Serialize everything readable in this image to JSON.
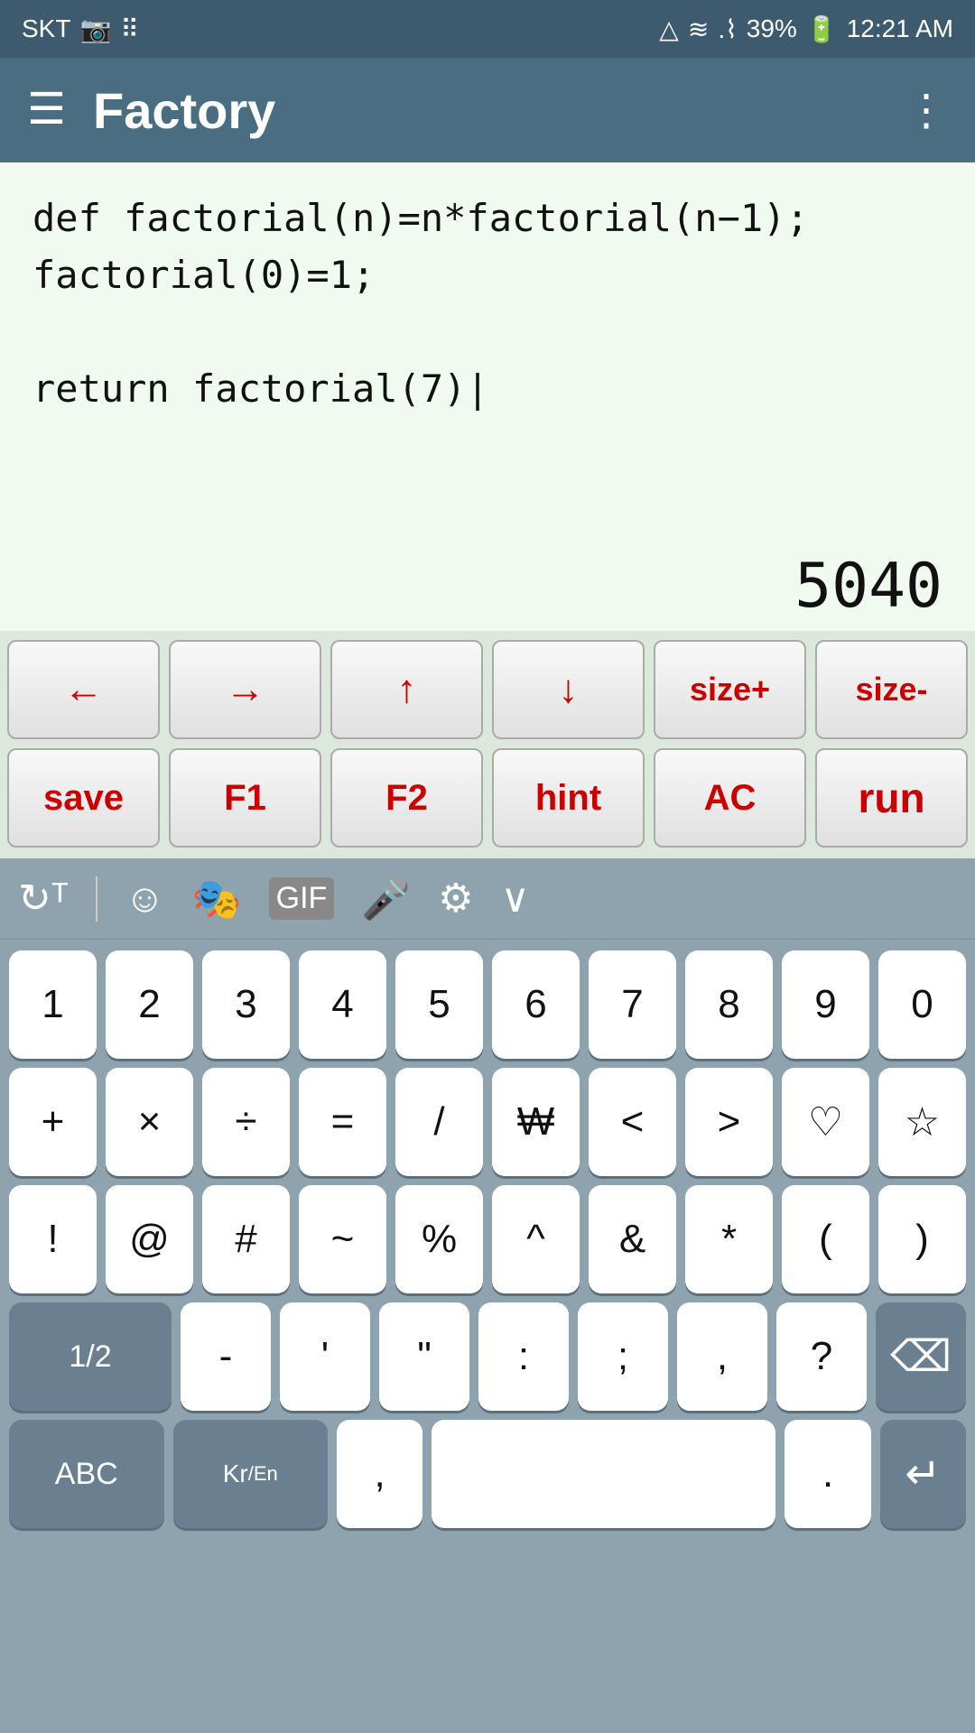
{
  "status_bar": {
    "carrier": "SKT",
    "signal_icons": "📷 ⠿",
    "network": "△ ≋",
    "battery_percent": "39%",
    "battery_icon": "🔋",
    "time": "12:21 AM"
  },
  "app_bar": {
    "title": "Factory",
    "menu_icon": "☰",
    "more_icon": "⋮"
  },
  "code": {
    "lines": "def factorial(n)=n*factorial(n−1);\nfactorial(0)=1;\n\nreturn factorial(7)|"
  },
  "result": {
    "value": "5040"
  },
  "toolbar_row1": {
    "buttons": [
      {
        "label": "←",
        "name": "left-arrow-btn"
      },
      {
        "label": "→",
        "name": "right-arrow-btn"
      },
      {
        "label": "↑",
        "name": "up-arrow-btn"
      },
      {
        "label": "↓",
        "name": "down-arrow-btn"
      },
      {
        "label": "size+",
        "name": "size-plus-btn"
      },
      {
        "label": "size-",
        "name": "size-minus-btn"
      }
    ]
  },
  "toolbar_row2": {
    "buttons": [
      {
        "label": "save",
        "name": "save-btn"
      },
      {
        "label": "F1",
        "name": "f1-btn"
      },
      {
        "label": "F2",
        "name": "f2-btn"
      },
      {
        "label": "hint",
        "name": "hint-btn"
      },
      {
        "label": "AC",
        "name": "ac-btn"
      },
      {
        "label": "run",
        "name": "run-btn"
      }
    ]
  },
  "keyboard": {
    "topbar_icons": [
      "↻",
      "|",
      "☺",
      "🎭",
      "GIF",
      "🎤",
      "⚙",
      "∨"
    ],
    "rows": [
      [
        "1",
        "2",
        "3",
        "4",
        "5",
        "6",
        "7",
        "8",
        "9",
        "0"
      ],
      [
        "+",
        "×",
        "÷",
        "=",
        "/",
        "₩",
        "<",
        ">",
        "♡",
        "☆"
      ],
      [
        "!",
        "@",
        "#",
        "~",
        "%",
        "^",
        "&",
        "*",
        "(",
        ")"
      ],
      [
        "1/2",
        "-",
        "'",
        "\"",
        ":",
        ";",
        ",",
        "?",
        "⌫"
      ],
      [
        "ABC",
        "Kr/En",
        ",",
        "       ",
        ".",
        "↵"
      ]
    ]
  }
}
